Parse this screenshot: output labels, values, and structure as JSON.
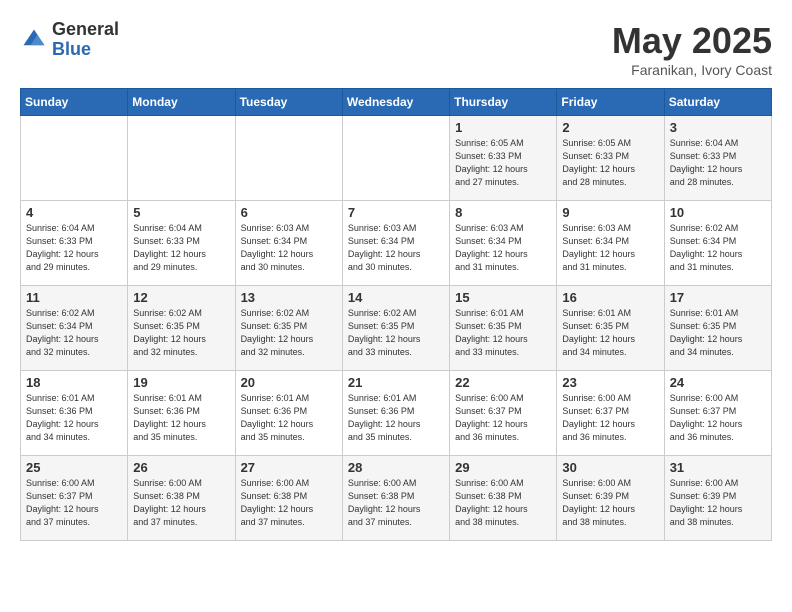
{
  "header": {
    "logo_general": "General",
    "logo_blue": "Blue",
    "month": "May 2025",
    "location": "Faranikan, Ivory Coast"
  },
  "weekdays": [
    "Sunday",
    "Monday",
    "Tuesday",
    "Wednesday",
    "Thursday",
    "Friday",
    "Saturday"
  ],
  "weeks": [
    [
      {
        "day": "",
        "info": ""
      },
      {
        "day": "",
        "info": ""
      },
      {
        "day": "",
        "info": ""
      },
      {
        "day": "",
        "info": ""
      },
      {
        "day": "1",
        "info": "Sunrise: 6:05 AM\nSunset: 6:33 PM\nDaylight: 12 hours\nand 27 minutes."
      },
      {
        "day": "2",
        "info": "Sunrise: 6:05 AM\nSunset: 6:33 PM\nDaylight: 12 hours\nand 28 minutes."
      },
      {
        "day": "3",
        "info": "Sunrise: 6:04 AM\nSunset: 6:33 PM\nDaylight: 12 hours\nand 28 minutes."
      }
    ],
    [
      {
        "day": "4",
        "info": "Sunrise: 6:04 AM\nSunset: 6:33 PM\nDaylight: 12 hours\nand 29 minutes."
      },
      {
        "day": "5",
        "info": "Sunrise: 6:04 AM\nSunset: 6:33 PM\nDaylight: 12 hours\nand 29 minutes."
      },
      {
        "day": "6",
        "info": "Sunrise: 6:03 AM\nSunset: 6:34 PM\nDaylight: 12 hours\nand 30 minutes."
      },
      {
        "day": "7",
        "info": "Sunrise: 6:03 AM\nSunset: 6:34 PM\nDaylight: 12 hours\nand 30 minutes."
      },
      {
        "day": "8",
        "info": "Sunrise: 6:03 AM\nSunset: 6:34 PM\nDaylight: 12 hours\nand 31 minutes."
      },
      {
        "day": "9",
        "info": "Sunrise: 6:03 AM\nSunset: 6:34 PM\nDaylight: 12 hours\nand 31 minutes."
      },
      {
        "day": "10",
        "info": "Sunrise: 6:02 AM\nSunset: 6:34 PM\nDaylight: 12 hours\nand 31 minutes."
      }
    ],
    [
      {
        "day": "11",
        "info": "Sunrise: 6:02 AM\nSunset: 6:34 PM\nDaylight: 12 hours\nand 32 minutes."
      },
      {
        "day": "12",
        "info": "Sunrise: 6:02 AM\nSunset: 6:35 PM\nDaylight: 12 hours\nand 32 minutes."
      },
      {
        "day": "13",
        "info": "Sunrise: 6:02 AM\nSunset: 6:35 PM\nDaylight: 12 hours\nand 32 minutes."
      },
      {
        "day": "14",
        "info": "Sunrise: 6:02 AM\nSunset: 6:35 PM\nDaylight: 12 hours\nand 33 minutes."
      },
      {
        "day": "15",
        "info": "Sunrise: 6:01 AM\nSunset: 6:35 PM\nDaylight: 12 hours\nand 33 minutes."
      },
      {
        "day": "16",
        "info": "Sunrise: 6:01 AM\nSunset: 6:35 PM\nDaylight: 12 hours\nand 34 minutes."
      },
      {
        "day": "17",
        "info": "Sunrise: 6:01 AM\nSunset: 6:35 PM\nDaylight: 12 hours\nand 34 minutes."
      }
    ],
    [
      {
        "day": "18",
        "info": "Sunrise: 6:01 AM\nSunset: 6:36 PM\nDaylight: 12 hours\nand 34 minutes."
      },
      {
        "day": "19",
        "info": "Sunrise: 6:01 AM\nSunset: 6:36 PM\nDaylight: 12 hours\nand 35 minutes."
      },
      {
        "day": "20",
        "info": "Sunrise: 6:01 AM\nSunset: 6:36 PM\nDaylight: 12 hours\nand 35 minutes."
      },
      {
        "day": "21",
        "info": "Sunrise: 6:01 AM\nSunset: 6:36 PM\nDaylight: 12 hours\nand 35 minutes."
      },
      {
        "day": "22",
        "info": "Sunrise: 6:00 AM\nSunset: 6:37 PM\nDaylight: 12 hours\nand 36 minutes."
      },
      {
        "day": "23",
        "info": "Sunrise: 6:00 AM\nSunset: 6:37 PM\nDaylight: 12 hours\nand 36 minutes."
      },
      {
        "day": "24",
        "info": "Sunrise: 6:00 AM\nSunset: 6:37 PM\nDaylight: 12 hours\nand 36 minutes."
      }
    ],
    [
      {
        "day": "25",
        "info": "Sunrise: 6:00 AM\nSunset: 6:37 PM\nDaylight: 12 hours\nand 37 minutes."
      },
      {
        "day": "26",
        "info": "Sunrise: 6:00 AM\nSunset: 6:38 PM\nDaylight: 12 hours\nand 37 minutes."
      },
      {
        "day": "27",
        "info": "Sunrise: 6:00 AM\nSunset: 6:38 PM\nDaylight: 12 hours\nand 37 minutes."
      },
      {
        "day": "28",
        "info": "Sunrise: 6:00 AM\nSunset: 6:38 PM\nDaylight: 12 hours\nand 37 minutes."
      },
      {
        "day": "29",
        "info": "Sunrise: 6:00 AM\nSunset: 6:38 PM\nDaylight: 12 hours\nand 38 minutes."
      },
      {
        "day": "30",
        "info": "Sunrise: 6:00 AM\nSunset: 6:39 PM\nDaylight: 12 hours\nand 38 minutes."
      },
      {
        "day": "31",
        "info": "Sunrise: 6:00 AM\nSunset: 6:39 PM\nDaylight: 12 hours\nand 38 minutes."
      }
    ]
  ]
}
